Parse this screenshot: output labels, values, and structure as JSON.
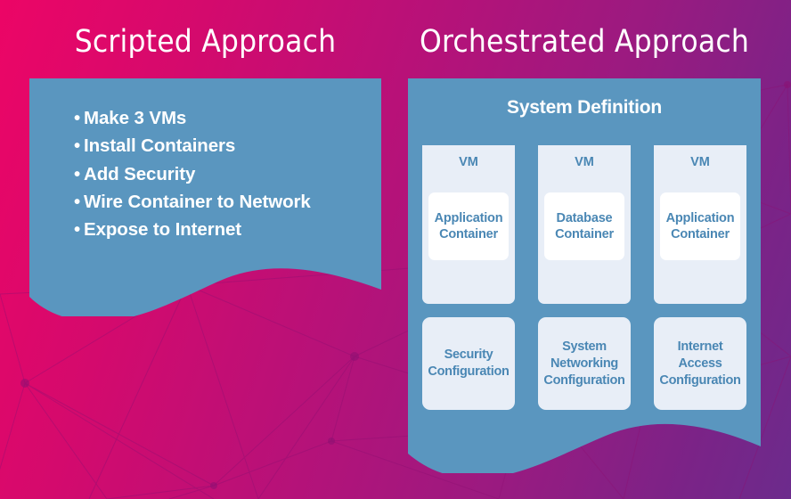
{
  "background": {
    "gradient_from": "#ec0566",
    "gradient_to": "#6c2b8c",
    "pattern": "network-constellation"
  },
  "panel_color": "#5a96bf",
  "card_color": "#e8eef7",
  "card_text_color": "#4a87b4",
  "left": {
    "title": "Scripted Approach",
    "bullets": [
      "Make 3 VMs",
      "Install Containers",
      "Add Security",
      "Wire Container to Network",
      "Expose to Internet"
    ],
    "bullet_glyph": "•"
  },
  "right": {
    "title": "Orchestrated Approach",
    "system_definition_label": "System Definition",
    "vms": [
      {
        "label": "VM",
        "container": "Application Container"
      },
      {
        "label": "VM",
        "container": "Database Container"
      },
      {
        "label": "VM",
        "container": "Application Container"
      }
    ],
    "configs": [
      "Security Configuration",
      "System Networking Configuration",
      "Internet Access Configuration"
    ]
  }
}
